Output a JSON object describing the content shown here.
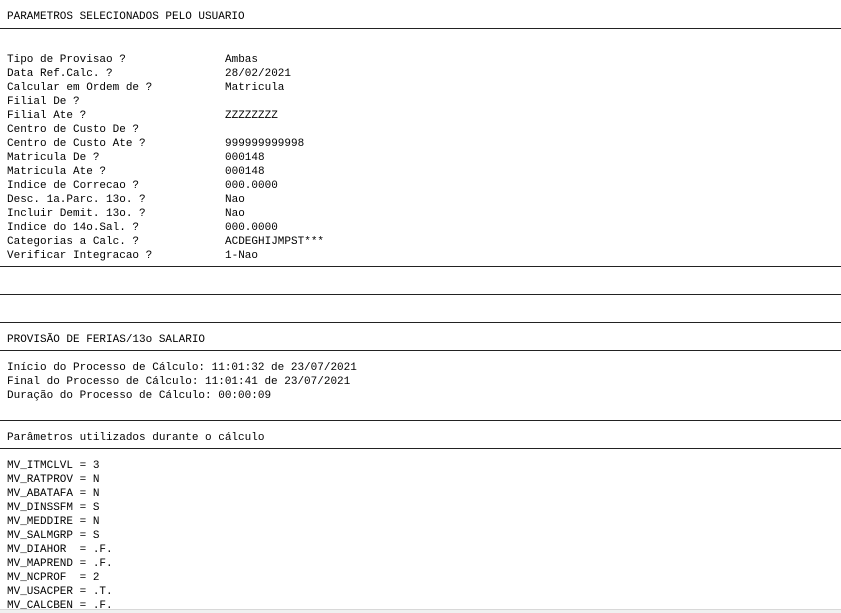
{
  "report": {
    "params_header": "PARAMETROS SELECIONADOS PELO USUARIO",
    "params": [
      {
        "label": "Tipo de Provisao ?",
        "value": "Ambas"
      },
      {
        "label": "Data Ref.Calc. ?",
        "value": "28/02/2021"
      },
      {
        "label": "Calcular em Ordem de ?",
        "value": "Matricula"
      },
      {
        "label": "Filial De ?",
        "value": ""
      },
      {
        "label": "Filial Ate ?",
        "value": "ZZZZZZZZ"
      },
      {
        "label": "Centro de Custo De ?",
        "value": ""
      },
      {
        "label": "Centro de Custo Ate ?",
        "value": "999999999998"
      },
      {
        "label": "Matricula De ?",
        "value": "000148"
      },
      {
        "label": "Matricula Ate ?",
        "value": "000148"
      },
      {
        "label": "Indice de Correcao ?",
        "value": "000.0000"
      },
      {
        "label": "Desc. 1a.Parc. 13o. ?",
        "value": "Nao"
      },
      {
        "label": "Incluir Demit. 13o. ?",
        "value": "Nao"
      },
      {
        "label": "Indice do 14o.Sal. ?",
        "value": "000.0000"
      },
      {
        "label": "Categorias a Calc. ?",
        "value": "ACDEGHIJMPST***"
      },
      {
        "label": "Verificar Integracao ?",
        "value": "1-Nao"
      }
    ],
    "process_header": "PROVISÃO DE FERIAS/13o SALARIO",
    "process_lines": [
      "Início do Processo de Cálculo: 11:01:32 de 23/07/2021",
      "Final do Processo de Cálculo: 11:01:41 de 23/07/2021",
      "Duração do Processo de Cálculo: 00:00:09"
    ],
    "calc_params_header": "Parâmetros utilizados durante o cálculo",
    "mv_lines": [
      "MV_ITMCLVL = 3",
      "MV_RATPROV = N",
      "MV_ABATAFA = N",
      "MV_DINSSFM = S",
      "MV_MEDDIRE = N",
      "MV_SALMGRP = S",
      "MV_DIAHOR  = .F.",
      "MV_MAPREND = .F.",
      "MV_NCPROF  = 2",
      "MV_USACPER = .T.",
      "MV_CALCBEN = .F."
    ]
  }
}
